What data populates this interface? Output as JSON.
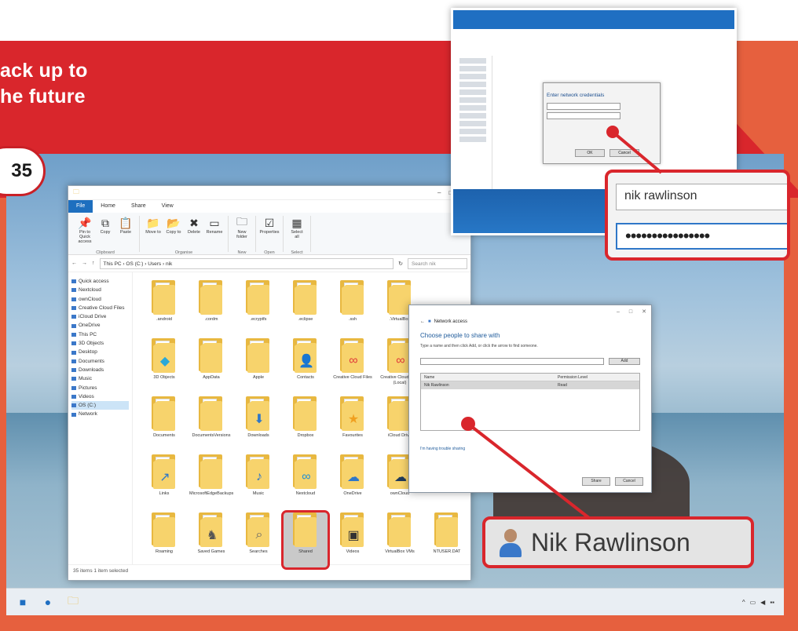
{
  "headline": {
    "line1": "ack up to",
    "line2": "he future"
  },
  "page_badge": "35",
  "explorer": {
    "ribbon_tabs": [
      "File",
      "Home",
      "Share",
      "View"
    ],
    "ribbon_buttons": [
      {
        "label": "Pin to Quick access",
        "icon": "pin-icon",
        "glyph": "📌"
      },
      {
        "label": "Copy",
        "icon": "copy-icon",
        "glyph": "⧉"
      },
      {
        "label": "Paste",
        "icon": "paste-icon",
        "glyph": "📋"
      },
      {
        "label": "Move to",
        "icon": "move-icon",
        "glyph": "📁"
      },
      {
        "label": "Copy to",
        "icon": "copy-to-icon",
        "glyph": "📂"
      },
      {
        "label": "Delete",
        "icon": "delete-icon",
        "glyph": "✖"
      },
      {
        "label": "Rename",
        "icon": "rename-icon",
        "glyph": "▭"
      },
      {
        "label": "New folder",
        "icon": "new-folder-icon",
        "glyph": "🗀"
      },
      {
        "label": "Properties",
        "icon": "properties-icon",
        "glyph": "☑"
      },
      {
        "label": "Select all",
        "icon": "select-all-icon",
        "glyph": "▦"
      }
    ],
    "ribbon_groups": [
      "Clipboard",
      "Organise",
      "New",
      "Open",
      "Select"
    ],
    "address": "This PC  ›  OS (C:)  ›  Users  ›  nik",
    "search_placeholder": "Search nik",
    "nav_items": [
      "Quick access",
      "Nextcloud",
      "ownCloud",
      "Creative Cloud Files",
      "iCloud Drive",
      "OneDrive",
      "This PC",
      "3D Objects",
      "Desktop",
      "Documents",
      "Downloads",
      "Music",
      "Pictures",
      "Videos",
      "OS (C:)",
      "Network"
    ],
    "folders": [
      {
        "label": ".android",
        "overlay": "",
        "color": ""
      },
      {
        "label": ".cordm",
        "overlay": "",
        "color": ""
      },
      {
        "label": ".ecryptfs",
        "overlay": "",
        "color": ""
      },
      {
        "label": ".eclipse",
        "overlay": "",
        "color": ""
      },
      {
        "label": ".ssh",
        "overlay": "",
        "color": ""
      },
      {
        "label": ".VirtualBox",
        "overlay": "",
        "color": ""
      },
      {
        "label": "",
        "overlay": "",
        "color": ""
      },
      {
        "label": "3D Objects",
        "overlay": "◆",
        "color": "#2aa8d8"
      },
      {
        "label": "AppData",
        "overlay": "",
        "color": ""
      },
      {
        "label": "Apple",
        "overlay": "",
        "color": ""
      },
      {
        "label": "Contacts",
        "overlay": "👤",
        "color": "#4a90d9"
      },
      {
        "label": "Creative Cloud Files",
        "overlay": "∞",
        "color": "#e03a3a"
      },
      {
        "label": "Creative Cloud Files (Local)",
        "overlay": "∞",
        "color": "#e03a3a"
      },
      {
        "label": "",
        "overlay": "",
        "color": ""
      },
      {
        "label": "Documents",
        "overlay": "",
        "color": ""
      },
      {
        "label": "DocumentsVersions",
        "overlay": "",
        "color": ""
      },
      {
        "label": "Downloads",
        "overlay": "⬇",
        "color": "#2f77c8"
      },
      {
        "label": "Dropbox",
        "overlay": "",
        "color": ""
      },
      {
        "label": "Favourites",
        "overlay": "★",
        "color": "#f0a020"
      },
      {
        "label": "iCloud Drive",
        "overlay": "",
        "color": ""
      },
      {
        "label": "",
        "overlay": "",
        "color": ""
      },
      {
        "label": "Links",
        "overlay": "↗",
        "color": "#2f77c8"
      },
      {
        "label": "MicrosoftEdgeBackups",
        "overlay": "",
        "color": ""
      },
      {
        "label": "Music",
        "overlay": "♪",
        "color": "#2f77c8"
      },
      {
        "label": "Nextcloud",
        "overlay": "∞",
        "color": "#1f8fd6"
      },
      {
        "label": "OneDrive",
        "overlay": "☁",
        "color": "#2f77c8"
      },
      {
        "label": "ownCloud",
        "overlay": "☁",
        "color": "#1f3a5a"
      },
      {
        "label": "",
        "overlay": "",
        "color": ""
      },
      {
        "label": "Roaming",
        "overlay": "",
        "color": ""
      },
      {
        "label": "Saved Games",
        "overlay": "♞",
        "color": "#555"
      },
      {
        "label": "Searches",
        "overlay": "⌕",
        "color": "#666"
      },
      {
        "label": "Shared",
        "overlay": "",
        "color": ""
      },
      {
        "label": "Videos",
        "overlay": "▣",
        "color": "#333"
      },
      {
        "label": "VirtualBox VMs",
        "overlay": "",
        "color": ""
      },
      {
        "label": "NTUSER.DAT",
        "overlay": "",
        "color": ""
      }
    ],
    "status": "35 items    1 item selected"
  },
  "network": {
    "dialog_title": "Enter network credentials",
    "ok": "OK",
    "cancel": "Cancel"
  },
  "credentials": {
    "username": "nik rawlinson",
    "password": "••••••••••••••••"
  },
  "share": {
    "header": "Network access",
    "title": "Choose people to share with",
    "description": "Type a name and then click Add, or click the arrow to find someone.",
    "add": "Add",
    "col_name": "Name",
    "col_perm": "Permission Level",
    "row_name": "Nik Rawlinson",
    "row_perm": "Read",
    "help_link": "I'm having trouble sharing",
    "share_btn": "Share",
    "cancel_btn": "Cancel"
  },
  "name_callout": "Nik Rawlinson",
  "colors": {
    "accent_red": "#d9262c",
    "salmon": "#e6603e",
    "windows_blue": "#1f6fc2"
  }
}
